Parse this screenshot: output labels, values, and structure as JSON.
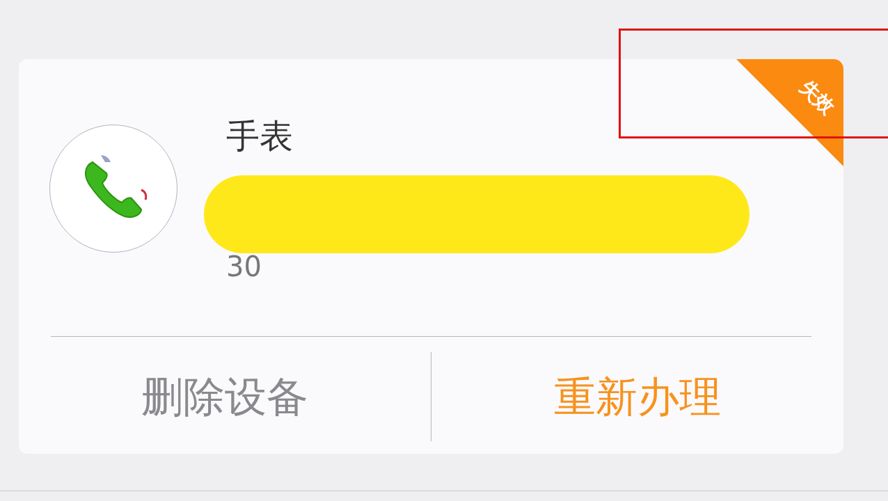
{
  "device": {
    "title": "手表",
    "detail": "30",
    "status_badge": "失效",
    "actions": [
      {
        "label": "删除设备",
        "kind": "secondary"
      },
      {
        "label": "重新办理",
        "kind": "primary"
      }
    ]
  }
}
